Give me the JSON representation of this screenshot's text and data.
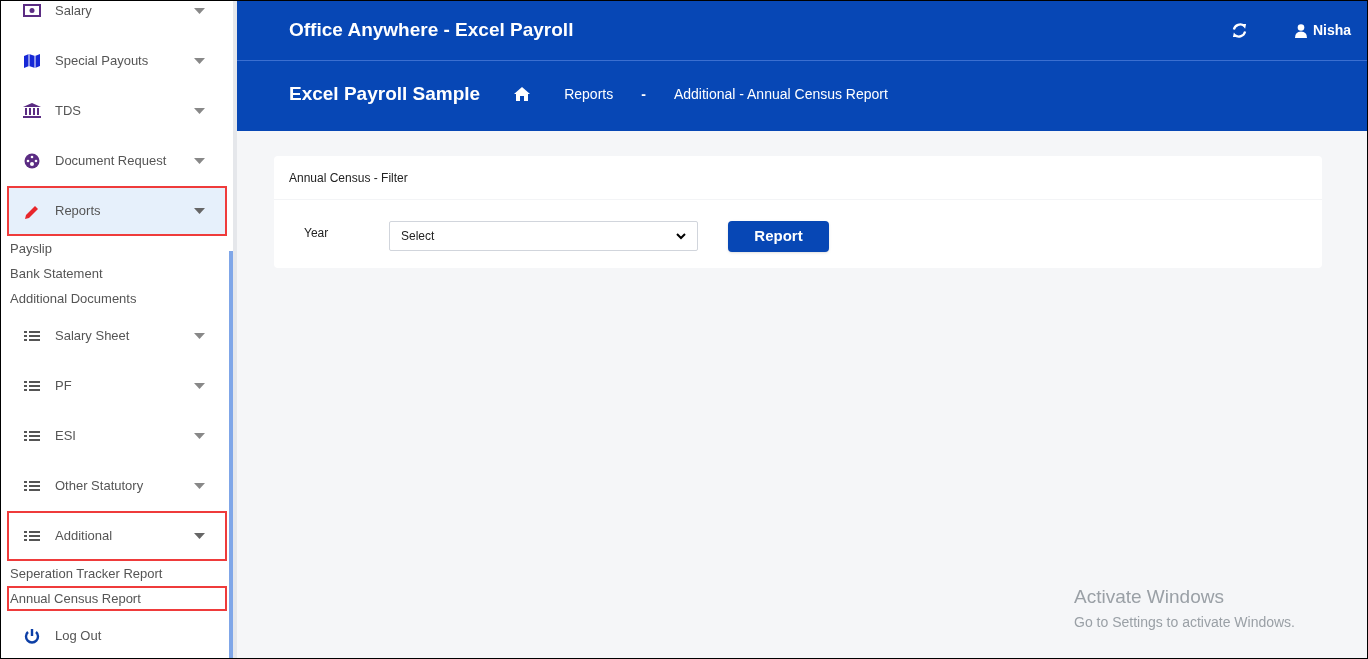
{
  "sidebar": {
    "items": [
      {
        "kind": "money",
        "label": "Salary",
        "selected": false,
        "expanded": false,
        "highlighted": false
      },
      {
        "kind": "map",
        "label": "Special Payouts",
        "selected": false,
        "expanded": false,
        "highlighted": false
      },
      {
        "kind": "bank",
        "label": "TDS",
        "selected": false,
        "expanded": false,
        "highlighted": false
      },
      {
        "kind": "palette",
        "label": "Document Request",
        "selected": false,
        "expanded": false,
        "highlighted": false
      },
      {
        "kind": "pencil",
        "label": "Reports",
        "selected": true,
        "expanded": true,
        "highlighted": true,
        "children": [
          {
            "label": "Payslip",
            "highlighted": false
          },
          {
            "label": "Bank Statement",
            "highlighted": false
          },
          {
            "label": "Additional Documents",
            "highlighted": false
          }
        ]
      },
      {
        "kind": "list",
        "label": "Salary Sheet",
        "selected": false,
        "expanded": false,
        "highlighted": false
      },
      {
        "kind": "list",
        "label": "PF",
        "selected": false,
        "expanded": false,
        "highlighted": false
      },
      {
        "kind": "list",
        "label": "ESI",
        "selected": false,
        "expanded": false,
        "highlighted": false
      },
      {
        "kind": "list",
        "label": "Other Statutory",
        "selected": false,
        "expanded": false,
        "highlighted": false
      },
      {
        "kind": "list",
        "label": "Additional",
        "selected": false,
        "expanded": true,
        "highlighted": true,
        "children": [
          {
            "label": "Seperation Tracker Report",
            "highlighted": false
          },
          {
            "label": "Annual Census Report",
            "highlighted": true
          }
        ]
      },
      {
        "kind": "power",
        "label": "Log Out",
        "selected": false,
        "highlighted": false
      }
    ]
  },
  "header": {
    "app_title": "Office Anywhere - Excel Payroll",
    "user": "Nisha",
    "company": "Excel Payroll Sample",
    "breadcrumb": [
      "Reports",
      "Additional - Annual Census Report"
    ],
    "breadcrumb_separator": "-"
  },
  "filter_card": {
    "title": "Annual Census - Filter",
    "year_label": "Year",
    "year_value": "Select",
    "button": "Report"
  },
  "os_notice": {
    "title": "Activate Windows",
    "subtitle": "Go to Settings to activate Windows."
  }
}
